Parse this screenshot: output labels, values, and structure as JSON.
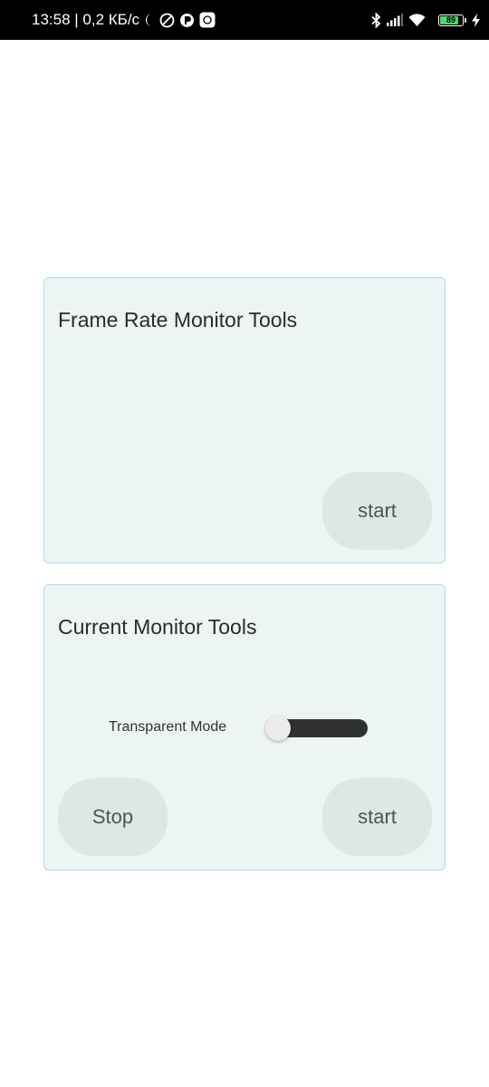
{
  "status_bar": {
    "time_and_speed": "13:58 | 0,2 КБ/с",
    "battery_level": "89",
    "battery_fraction": 0.89,
    "icons": [
      "moon-icon",
      "no-disturb-icon",
      "app-notification-icon",
      "screen-recorder-icon",
      "bluetooth-icon",
      "signal-icon",
      "wifi-icon",
      "battery-icon",
      "charging-icon"
    ],
    "battery_color": "#4cd964"
  },
  "frame_rate_card": {
    "title": "Frame Rate Monitor Tools",
    "start_label": "start"
  },
  "current_card": {
    "title": "Current Monitor Tools",
    "toggle_label": "Transparent Mode",
    "toggle_on": false,
    "stop_label": "Stop",
    "start_label": "start"
  },
  "colors": {
    "card_background": "#edf5f4",
    "card_border": "#a9dcef",
    "button_background": "#dfe7e6",
    "button_text": "#4d5554",
    "switch_track": "#2e3130"
  }
}
